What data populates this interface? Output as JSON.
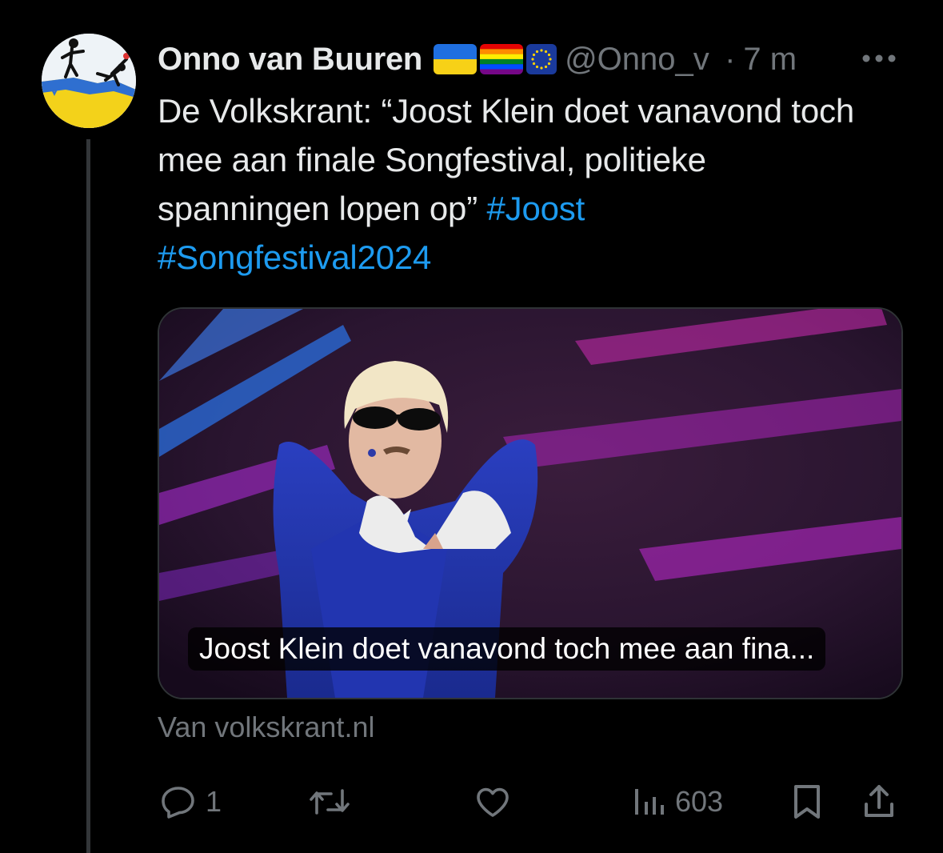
{
  "author": {
    "name": "Onno van Buuren",
    "handle": "@Onno_v",
    "separator": "·",
    "time": "7 m"
  },
  "flags": [
    "ukraine-flag-icon",
    "rainbow-flag-icon",
    "eu-flag-icon"
  ],
  "tweet": {
    "text": "De Volkskrant: “Joost Klein doet vanavond toch mee aan finale Songfestival, politieke spanningen lopen op”",
    "hashtags": [
      "#Joost",
      "#Songfestival2024"
    ]
  },
  "card": {
    "caption": "Joost Klein doet vanavond toch mee aan fina...",
    "source": "Van volkskrant.nl"
  },
  "actions": {
    "replies": "1",
    "retweets": "",
    "likes": "",
    "views": "603"
  },
  "colors": {
    "background": "#000000",
    "text": "#e7e9ea",
    "muted": "#71767b",
    "accent": "#1d9bf0",
    "border": "#2f3336"
  }
}
